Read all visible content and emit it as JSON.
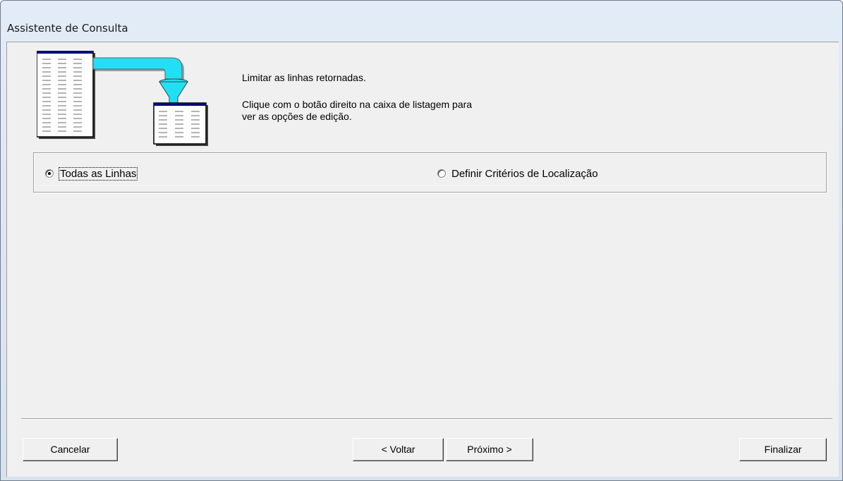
{
  "window": {
    "title": "Assistente de Consulta"
  },
  "instructions": {
    "line1": "Limitar as linhas retornadas.",
    "line2": "Clique com o botão direito na caixa de listagem para",
    "line3": "ver as opções de edição."
  },
  "options": {
    "all_rows": {
      "label": "Todas as Linhas",
      "checked": true
    },
    "criteria": {
      "label": "Definir Critérios de Localização",
      "checked": false
    }
  },
  "buttons": {
    "cancel": "Cancelar",
    "back": "< Voltar",
    "next": "Próximo >",
    "finish": "Finalizar"
  },
  "colors": {
    "flow_pipe": "#22e0f4",
    "funnel": "#22e0f4",
    "table_header": "#000080"
  },
  "icons": {
    "illustration": "table-filter-funnel-icon"
  }
}
